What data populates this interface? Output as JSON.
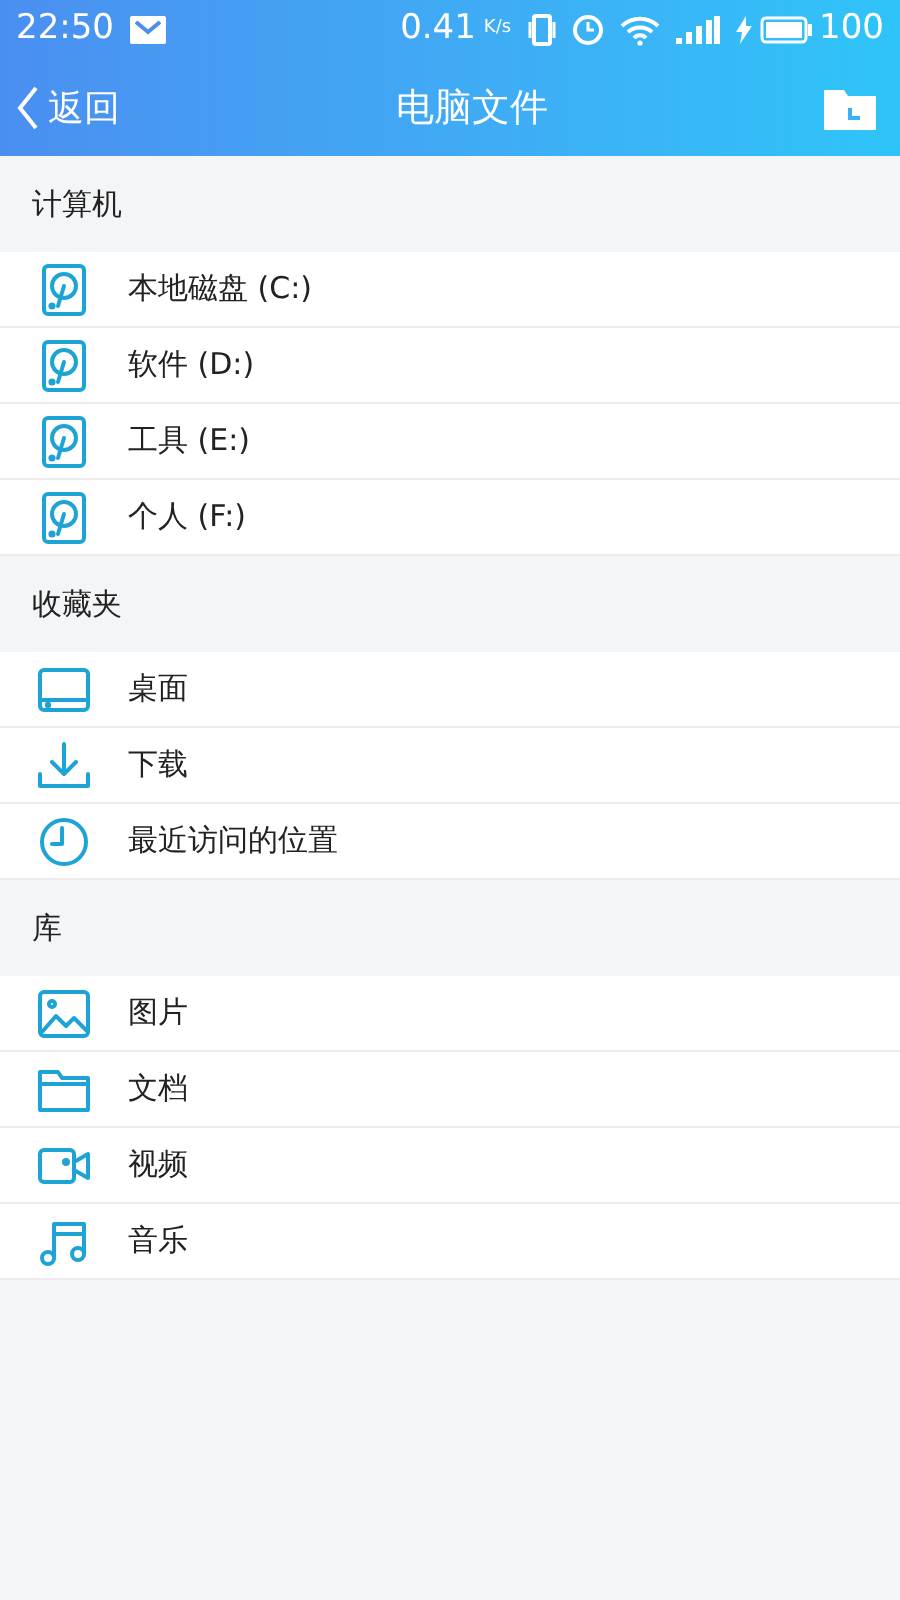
{
  "status_bar": {
    "time": "22:50",
    "speed": "0.41",
    "speed_unit": "K/s",
    "battery": "100"
  },
  "header": {
    "back": "返回",
    "title": "电脑文件"
  },
  "sections": [
    {
      "title": "计算机",
      "items": [
        {
          "label": "本地磁盘 (C:)",
          "kind": "drive"
        },
        {
          "label": "软件 (D:)",
          "kind": "drive"
        },
        {
          "label": "工具 (E:)",
          "kind": "drive"
        },
        {
          "label": "个人 (F:)",
          "kind": "drive"
        }
      ]
    },
    {
      "title": "收藏夹",
      "items": [
        {
          "label": "桌面",
          "kind": "desktop"
        },
        {
          "label": "下载",
          "kind": "download"
        },
        {
          "label": "最近访问的位置",
          "kind": "recent"
        }
      ]
    },
    {
      "title": "库",
      "items": [
        {
          "label": "图片",
          "kind": "image"
        },
        {
          "label": "文档",
          "kind": "folder"
        },
        {
          "label": "视频",
          "kind": "video"
        },
        {
          "label": "音乐",
          "kind": "music"
        }
      ]
    }
  ]
}
